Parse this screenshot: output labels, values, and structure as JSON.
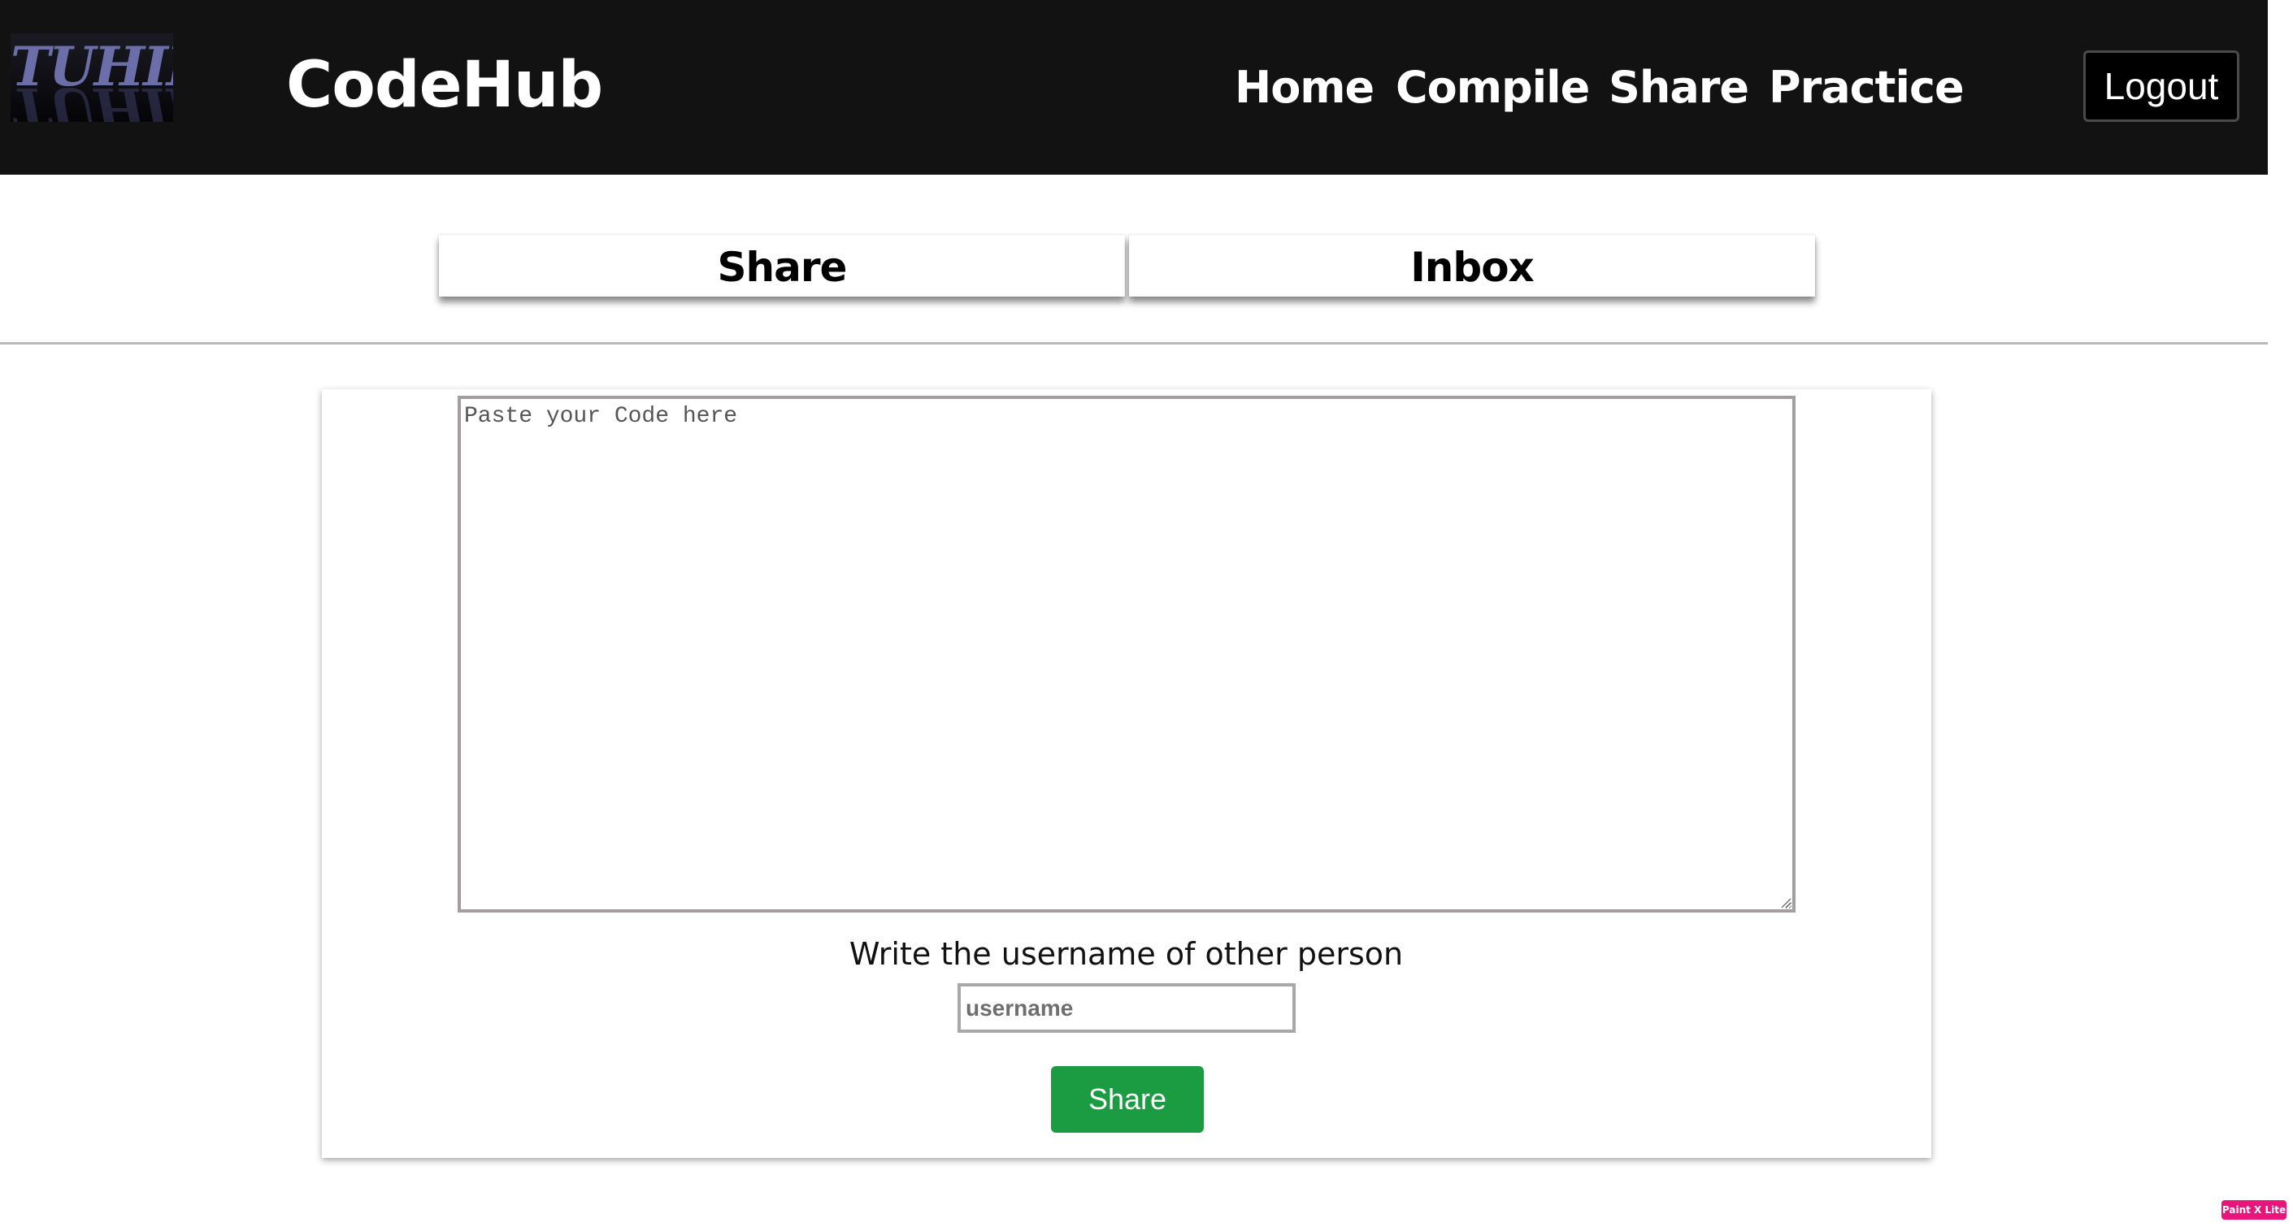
{
  "header": {
    "logo_text": "TUHIN",
    "brand": "CodeHub",
    "nav": [
      "Home",
      "Compile",
      "Share",
      "Practice"
    ],
    "logout_label": "Logout"
  },
  "tabs": {
    "share_label": "Share",
    "inbox_label": "Inbox"
  },
  "form": {
    "code_placeholder": "Paste your Code here",
    "code_value": "",
    "username_prompt": "Write the username of other person",
    "username_placeholder": "username",
    "username_value": "",
    "submit_label": "Share",
    "submit_color": "#1c9c42"
  },
  "corner_badge": "Paint X Lite"
}
